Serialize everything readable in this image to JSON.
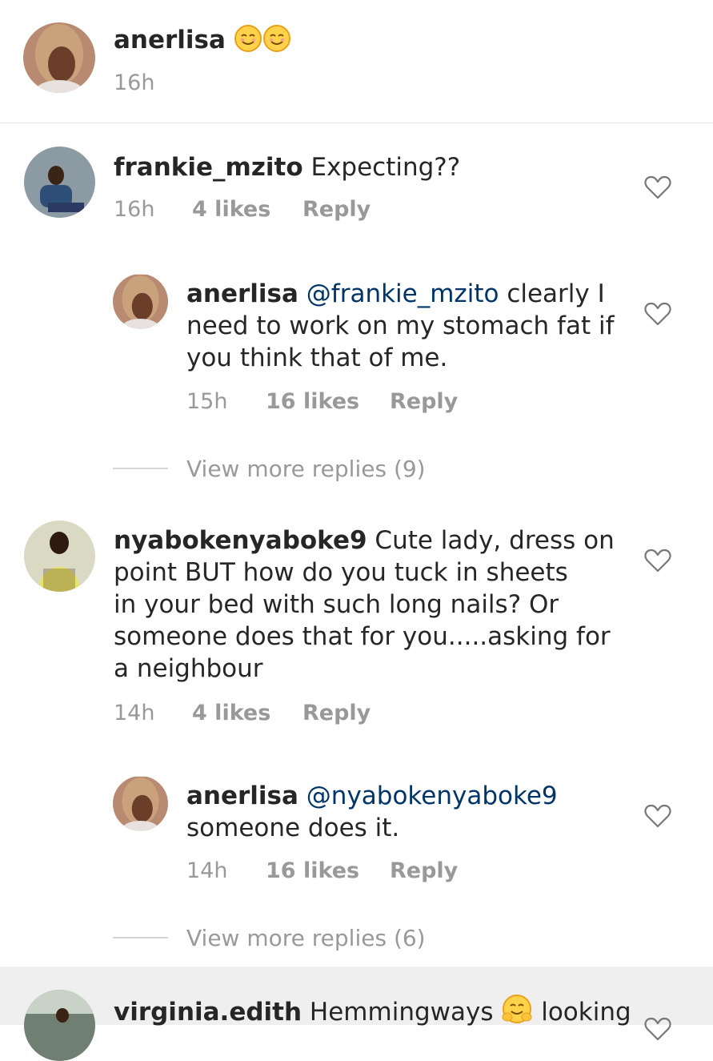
{
  "caption": {
    "username": "anerlisa",
    "emojis": [
      "smiling-face-icon",
      "smiling-face-icon"
    ],
    "time": "16h"
  },
  "comments": [
    {
      "username": "frankie_mzito",
      "text": "Expecting??",
      "time": "16h",
      "likes": "4 likes",
      "reply": "Reply"
    },
    {
      "username": "anerlisa",
      "mention": "@frankie_mzito",
      "text_line1": "clearly I",
      "text_line2": "need to work on my stomach fat if",
      "text_line3": "you think that of me.",
      "time": "15h",
      "likes": "16 likes",
      "reply": "Reply"
    },
    {
      "view_more": "View more replies (9)"
    },
    {
      "username": "nyabokenyaboke9",
      "text_line1": "Cute lady, dress on",
      "text_line2": "point BUT how do you tuck in sheets",
      "text_line3": "in your bed with such long nails?  Or",
      "text_line4": "someone does that for you.....asking for",
      "text_line5": "a neighbour",
      "time": "14h",
      "likes": "4 likes",
      "reply": "Reply"
    },
    {
      "username": "anerlisa",
      "mention": "@nyabokenyaboke9",
      "text_line2": "someone does it.",
      "time": "14h",
      "likes": "16 likes",
      "reply": "Reply"
    },
    {
      "view_more": "View more replies (6)"
    },
    {
      "username": "virginia.edith",
      "text_a": "Hemmingways",
      "text_b": "looking"
    }
  ],
  "colors": {
    "mention": "#003569",
    "meta": "#999999",
    "text": "#262626",
    "highlight_bg": "#efefef"
  }
}
